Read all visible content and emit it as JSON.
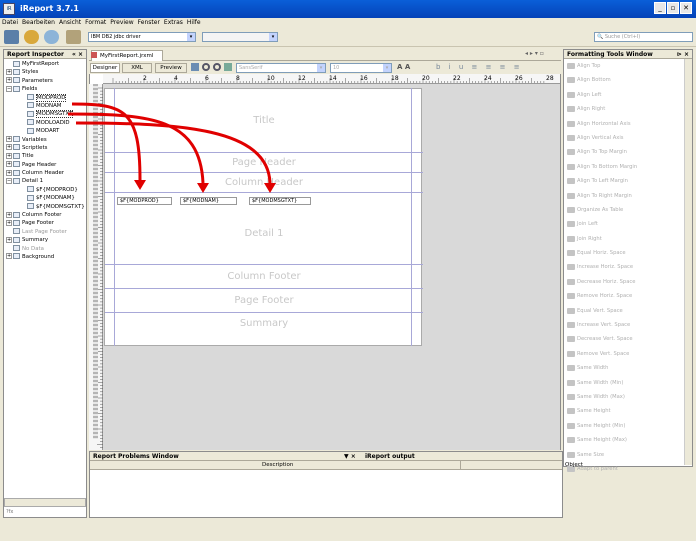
{
  "app": {
    "title": "iReport 3.7.1",
    "logo": "iR"
  },
  "window_controls": {
    "minimize": "_",
    "maximize": "▫",
    "close": "✕"
  },
  "menu": [
    "Datei",
    "Bearbeiten",
    "Ansicht",
    "Format",
    "Preview",
    "Fenster",
    "Extras",
    "Hilfe"
  ],
  "toolbar": {
    "datasource": "IBM DB2 jdbc driver",
    "search_placeholder": "Suche (Ctrl+I)"
  },
  "inspector": {
    "title": "Report Inspector",
    "controls": "« ×",
    "tree": [
      {
        "label": "MyFirstReport",
        "level": 0,
        "exp": ""
      },
      {
        "label": "Styles",
        "level": 0,
        "exp": "+"
      },
      {
        "label": "Parameters",
        "level": 0,
        "exp": "+"
      },
      {
        "label": "Fields",
        "level": 0,
        "exp": "−"
      },
      {
        "label": "MODPROD",
        "level": 1,
        "exp": "",
        "sel": true
      },
      {
        "label": "MODNAM",
        "level": 1,
        "exp": ""
      },
      {
        "label": "MODMSGTXT",
        "level": 1,
        "exp": "",
        "sel": true
      },
      {
        "label": "MODLOADID",
        "level": 1,
        "exp": ""
      },
      {
        "label": "MODART",
        "level": 1,
        "exp": ""
      },
      {
        "label": "Variables",
        "level": 0,
        "exp": "+"
      },
      {
        "label": "Scriptlets",
        "level": 0,
        "exp": "+"
      },
      {
        "label": "Title",
        "level": 0,
        "exp": "+"
      },
      {
        "label": "Page Header",
        "level": 0,
        "exp": "+"
      },
      {
        "label": "Column Header",
        "level": 0,
        "exp": "+"
      },
      {
        "label": "Detail 1",
        "level": 0,
        "exp": "−"
      },
      {
        "label": "$F{MODPROD}",
        "level": 1,
        "exp": ""
      },
      {
        "label": "$F{MODNAM}",
        "level": 1,
        "exp": ""
      },
      {
        "label": "$F{MODMSGTXT}",
        "level": 1,
        "exp": ""
      },
      {
        "label": "Column Footer",
        "level": 0,
        "exp": "+"
      },
      {
        "label": "Page Footer",
        "level": 0,
        "exp": "+"
      },
      {
        "label": "Last Page Footer",
        "level": 0,
        "exp": "",
        "grey": true
      },
      {
        "label": "Summary",
        "level": 0,
        "exp": "+"
      },
      {
        "label": "No Data",
        "level": 0,
        "exp": "",
        "grey": true
      },
      {
        "label": "Background",
        "level": 0,
        "exp": "+"
      }
    ],
    "bottom_tab": "?fx"
  },
  "editor": {
    "doc_tab": "MyFirstReport.jrxml",
    "tabs": [
      "Designer",
      "XML",
      "Preview"
    ],
    "font": "SansSerif",
    "font_size": "10",
    "ruler_labels": [
      "2",
      "4",
      "6",
      "8",
      "10",
      "12",
      "14",
      "16",
      "18",
      "20",
      "22",
      "24",
      "26",
      "28"
    ],
    "bands": [
      "Title",
      "Page Header",
      "Column Header",
      "Detail 1",
      "Column Footer",
      "Page Footer",
      "Summary"
    ],
    "fields": [
      "$F{MODPROD}",
      "$F{MODNAM}",
      "$F{MODMSGTXT}"
    ]
  },
  "formatting": {
    "title": "Formatting Tools Window",
    "controls": "⊳ ×",
    "items": [
      "Align Top",
      "Align Bottom",
      "Align Left",
      "Align Right",
      "Align Horizontal Axis",
      "Align Vertical Axis",
      "Align To Top Margin",
      "Align To Bottom Margin",
      "Align To Left Margin",
      "Align To Right Margin",
      "Organize As Table",
      "Join Left",
      "Join Right",
      "Equal Horiz. Space",
      "Increase Horiz. Space",
      "Decrease Horiz. Space",
      "Remove Horiz. Space",
      "Equal Vert. Space",
      "Increase Vert. Space",
      "Decrease Vert. Space",
      "Remove Vert. Space",
      "Same Width",
      "Same Width (Min)",
      "Same Width (Max)",
      "Same Height",
      "Same Height (Min)",
      "Same Height (Max)",
      "Same Size",
      "Adapt to parent"
    ]
  },
  "problems": {
    "title": "Report Problems Window",
    "controls": "▼ ×",
    "other_tab": "iReport output",
    "col_description": "Description",
    "col_object": "Object"
  },
  "colors": {
    "titlebar": "#0a5fd8",
    "arrow": "#e00000",
    "band_line": "#a8a8d8"
  }
}
